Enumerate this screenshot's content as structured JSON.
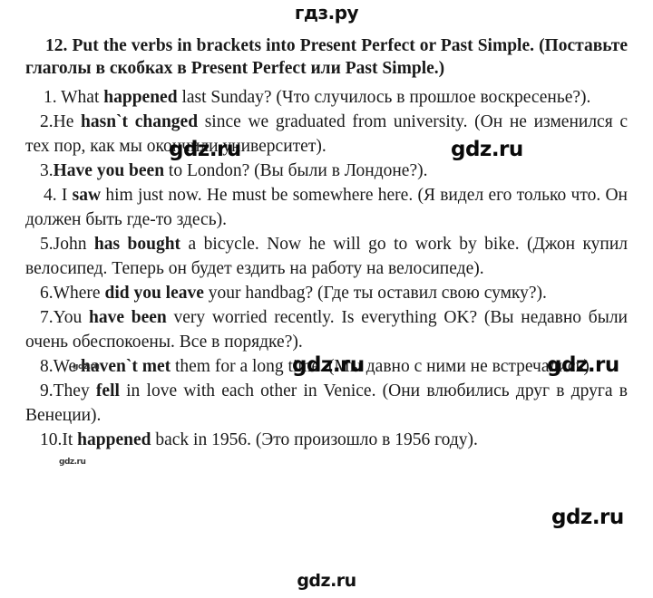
{
  "site": {
    "logo_top": "гдз.ру",
    "logo_bottom": "gdz.ru"
  },
  "exercise": {
    "number": "12.",
    "title_en": "Put the verbs in brackets into Present Perfect or Past Simple.",
    "title_ru": "(Поставьте глаголы в скобках в Present Perfect или Past Simple.)",
    "title_full": "12. Put the verbs in brackets into Present Perfect or Past Simple. (Поставьте глаголы в скобках в Present Perfect или Past Simple.)"
  },
  "items": [
    {
      "number": "1.",
      "pre": "What ",
      "answer": "happened",
      "post": " last Sunday? (Что случилось в прошлое воскресенье?)."
    },
    {
      "number": "2.",
      "pre": "He ",
      "answer": "hasn`t changed",
      "post": " since we graduated from university. (Он не изменился с тех пор, как мы окончили университет)."
    },
    {
      "number": "3.",
      "pre": "",
      "answer": "Have you been",
      "post": " to London? (Вы были в Лондоне?)."
    },
    {
      "number": "4.",
      "pre": "I ",
      "answer": "saw",
      "post": " him just now. He must be somewhere here. (Я видел его только что. Он должен быть где-то здесь)."
    },
    {
      "number": "5.",
      "pre": "John ",
      "answer": "has bought",
      "post": " a bicycle. Now he will go to work by bike. (Джон купил велосипед. Теперь он будет ездить на работу на велосипеде)."
    },
    {
      "number": "6.",
      "pre": "Where ",
      "answer": "did you leave",
      "post": " your handbag? (Где ты оставил свою сумку?)."
    },
    {
      "number": "7.",
      "pre": "You ",
      "answer": "have been",
      "post": " very worried recently. Is everything OK? (Вы недавно были очень обеспокоены. Все в порядке?)."
    },
    {
      "number": "8.",
      "pre": "We ",
      "answer": "haven`t met",
      "post": " them for a long time. (Мы давно с ними не встречались)."
    },
    {
      "number": "9.",
      "pre": "They ",
      "answer": "fell",
      "post": " in love with each other in Venice. (Они влюбились друг в друга в Венеции)."
    },
    {
      "number": "10.",
      "pre": "It ",
      "answer": "happened",
      "post": " back in 1956. (Это произошло в 1956 году)."
    }
  ],
  "watermarks": {
    "w1": "gdz.ru",
    "w2": "gdz.ru",
    "w3": "gdz.ru",
    "w4": "gdz.ru",
    "w5": "gdz.ru",
    "w6": "gdz.ru",
    "w7": "gdz.ru"
  }
}
